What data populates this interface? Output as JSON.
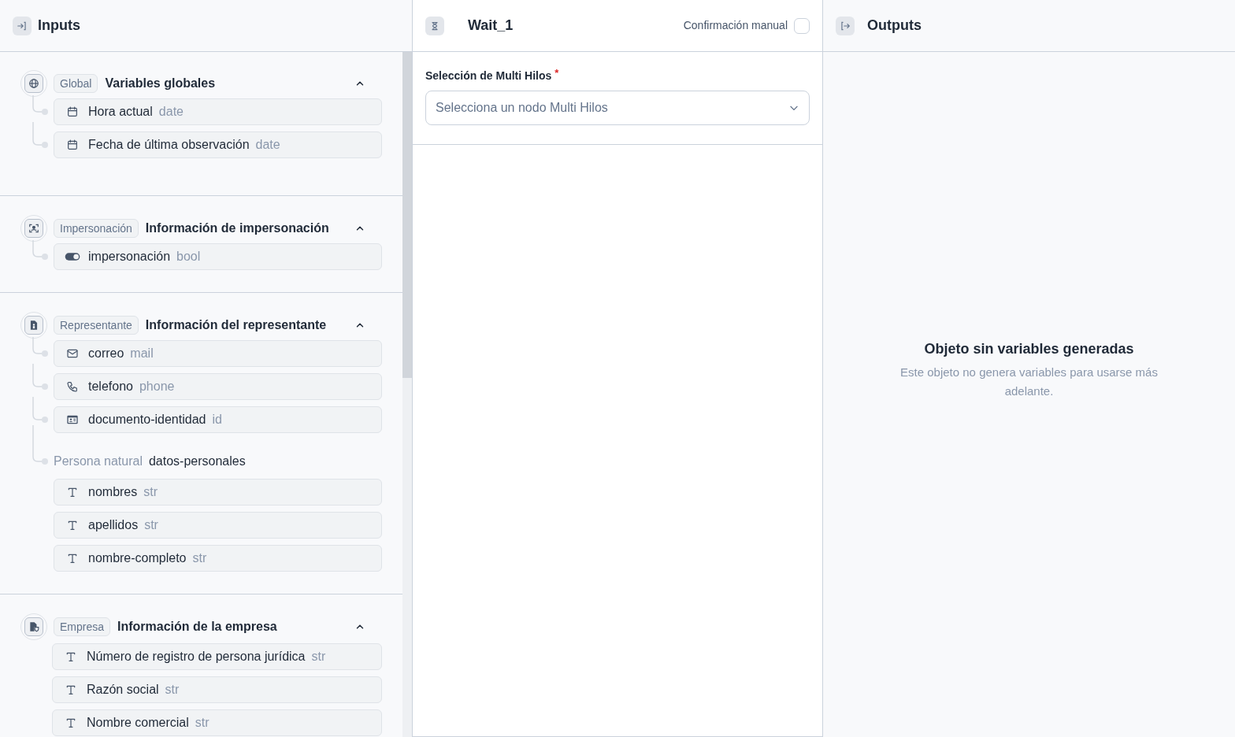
{
  "inputs": {
    "title": "Inputs",
    "sections": [
      {
        "tag": "Global",
        "title": "Variables globales",
        "expanded": true,
        "tree_lines": true,
        "items": [
          {
            "kind": "date",
            "label": "Hora actual",
            "type": "date"
          },
          {
            "kind": "date",
            "label": "Fecha de última observación",
            "type": "date"
          }
        ]
      },
      {
        "tag": "Impersonación",
        "title": "Información de impersonación",
        "expanded": true,
        "tree_lines": true,
        "items": [
          {
            "kind": "bool",
            "label": "impersonación",
            "type": "bool"
          }
        ]
      },
      {
        "tag": "Representante",
        "title": "Información del representante",
        "expanded": true,
        "tree_lines": true,
        "items": [
          {
            "kind": "mail",
            "label": "correo",
            "type": "mail"
          },
          {
            "kind": "phone",
            "label": "telefono",
            "type": "phone"
          },
          {
            "kind": "id",
            "label": "documento-identidad",
            "type": "id"
          },
          {
            "kind": "group",
            "tag": "Persona natural",
            "label": "datos-personales",
            "children": [
              {
                "kind": "str",
                "label": "nombres",
                "type": "str"
              },
              {
                "kind": "str",
                "label": "apellidos",
                "type": "str"
              },
              {
                "kind": "str",
                "label": "nombre-completo",
                "type": "str"
              }
            ]
          }
        ]
      },
      {
        "tag": "Empresa",
        "title": "Información de la empresa",
        "expanded": true,
        "tree_lines": false,
        "items": [
          {
            "kind": "str",
            "label": "Número de registro de persona jurídica",
            "type": "str"
          },
          {
            "kind": "str",
            "label": "Razón social",
            "type": "str"
          },
          {
            "kind": "str",
            "label": "Nombre comercial",
            "type": "str"
          }
        ]
      }
    ]
  },
  "node": {
    "title": "Wait_1",
    "manual_confirmation": {
      "label": "Confirmación manual",
      "checked": false
    },
    "field": {
      "label": "Selección de Multi Hilos",
      "required_mark": "*",
      "placeholder": "Selecciona un nodo Multi Hilos"
    }
  },
  "outputs": {
    "title": "Outputs",
    "empty_title": "Objeto sin variables generadas",
    "empty_text": "Este objeto no genera variables para usarse más adelante."
  }
}
